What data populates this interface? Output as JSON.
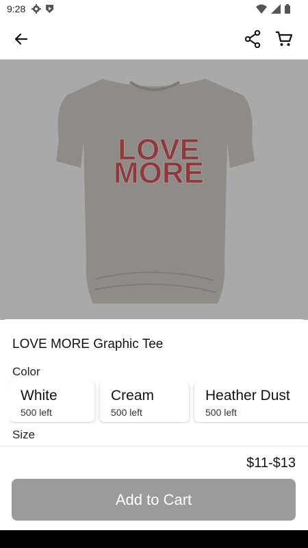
{
  "status_bar": {
    "time": "9:28",
    "icons_left": [
      "gear-icon",
      "play-shield-icon"
    ],
    "icons_right": [
      "wifi-icon",
      "signal-icon",
      "battery-icon"
    ]
  },
  "topbar": {
    "icons": [
      "back-arrow-icon",
      "share-icon",
      "cart-icon"
    ]
  },
  "product": {
    "image_text_line1": "LOVE",
    "image_text_line2": "MORE",
    "title": "LOVE MORE Graphic Tee",
    "color_label": "Color",
    "colors": [
      {
        "name": "White",
        "stock": "500 left"
      },
      {
        "name": "Cream",
        "stock": "500 left"
      },
      {
        "name": "Heather Dust",
        "stock": "500 left"
      }
    ],
    "size_label": "Size",
    "price": "$11-$13",
    "add_to_cart": "Add to Cart"
  },
  "colors": {
    "overlay": "#a9a9a9",
    "button_disabled": "#9b9b9b",
    "print_red": "#b3333a"
  }
}
